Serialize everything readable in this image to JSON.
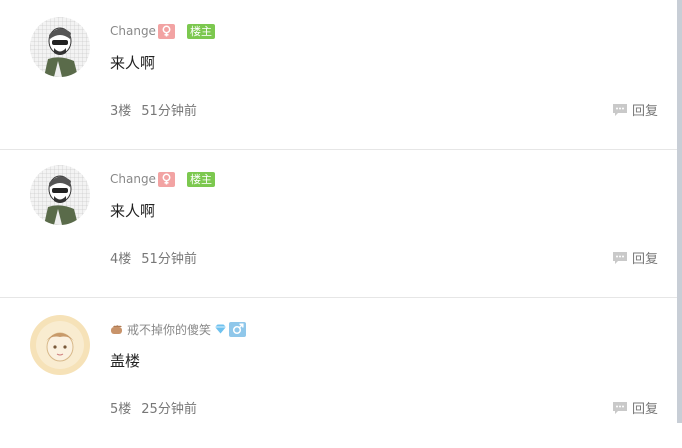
{
  "reply_label": "回复",
  "colors": {
    "owner_badge": "#7cc84f",
    "female_badge": "#f2a3a3",
    "male_badge": "#8fc7ea",
    "divider": "#e6e6e6"
  },
  "posts": [
    {
      "username": "Change",
      "gender_icon": "female-icon",
      "owner_badge": "楼主",
      "content": "来人啊",
      "floor": "3楼",
      "time": "51分钟前",
      "avatar": "sketch-avatar"
    },
    {
      "username": "Change",
      "gender_icon": "female-icon",
      "owner_badge": "楼主",
      "content": "来人啊",
      "floor": "4楼",
      "time": "51分钟前",
      "avatar": "sketch-avatar"
    },
    {
      "username": "戒不掉你的傻笑",
      "gender_icon": "male-icon",
      "content": "盖楼",
      "floor": "5楼",
      "time": "25分钟前",
      "avatar": "cartoon-avatar"
    }
  ]
}
